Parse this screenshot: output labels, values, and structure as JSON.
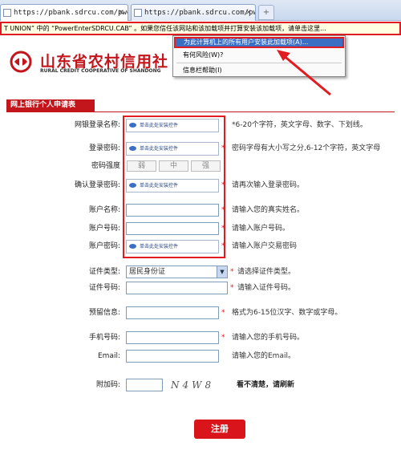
{
  "tabs": [
    {
      "title": "https://pbank.sdrcu.com/pwe",
      "close": "×"
    },
    {
      "title": "https://pbank.sdrcu.com/pwe",
      "close": "×"
    }
  ],
  "newtab": "+",
  "infobar": {
    "text": "T UNION” 中的 “PowerEnterSDRCU.CAB” 。如果您信任该网站和该加载项并打算安装该加载项，请单击这里..."
  },
  "context_menu": {
    "items": [
      {
        "label": "为此计算机上的所有用户安装此加载项(A)..."
      },
      {
        "label": "有何风险(W)?"
      },
      {
        "label": "信息栏帮助(I)"
      }
    ]
  },
  "logo": {
    "cn": "山东省农村信用社",
    "en": "RURAL CREDIT COOPERATIVE OF SHANDONG",
    "accent": "#c3161c"
  },
  "form": {
    "title": "网上银行个人申请表",
    "fields": {
      "login_name": {
        "label": "网银登录名称:",
        "hint": "*6-20个字符，英文字母、数字、下划线。",
        "secure_text": "单击此处安装控件"
      },
      "login_pwd": {
        "label": "登录密码:",
        "hint": "密码字母有大小写之分,6-12个字符，英文字母",
        "secure_text": "单击此处安装控件"
      },
      "strength": {
        "label": "密码强度",
        "levels": [
          "弱",
          "中",
          "强"
        ]
      },
      "confirm_pwd": {
        "label": "确认登录密码:",
        "hint": "请再次输入登录密码。",
        "secure_text": "单击此处安装控件"
      },
      "account_name": {
        "label": "账户名称:",
        "hint": "请输入您的真实姓名。"
      },
      "account_no": {
        "label": "账户号码:",
        "hint": "请输入账户号码。"
      },
      "account_pwd": {
        "label": "账户密码:",
        "hint": "请输入账户交易密码",
        "secure_text": "单击此处安装控件"
      },
      "id_type": {
        "label": "证件类型:",
        "value": "居民身份证",
        "hint": "请选择证件类型。"
      },
      "id_no": {
        "label": "证件号码:",
        "hint": "请输入证件号码。"
      },
      "reserved": {
        "label": "预留信息:",
        "hint": "格式为6-15位汉字、数字或字母。"
      },
      "mobile": {
        "label": "手机号码:",
        "hint": "请输入您的手机号码。"
      },
      "email": {
        "label": "Email:",
        "hint": "请输入您的Email。"
      },
      "captcha": {
        "label": "附加码:",
        "image_text": "N4W8",
        "refresh": "看不清楚，请刷新"
      }
    },
    "star": "*",
    "submit": "注册"
  },
  "colors": {
    "alert_red": "#e01b22",
    "highlight_blue": "#3b6fc4"
  }
}
